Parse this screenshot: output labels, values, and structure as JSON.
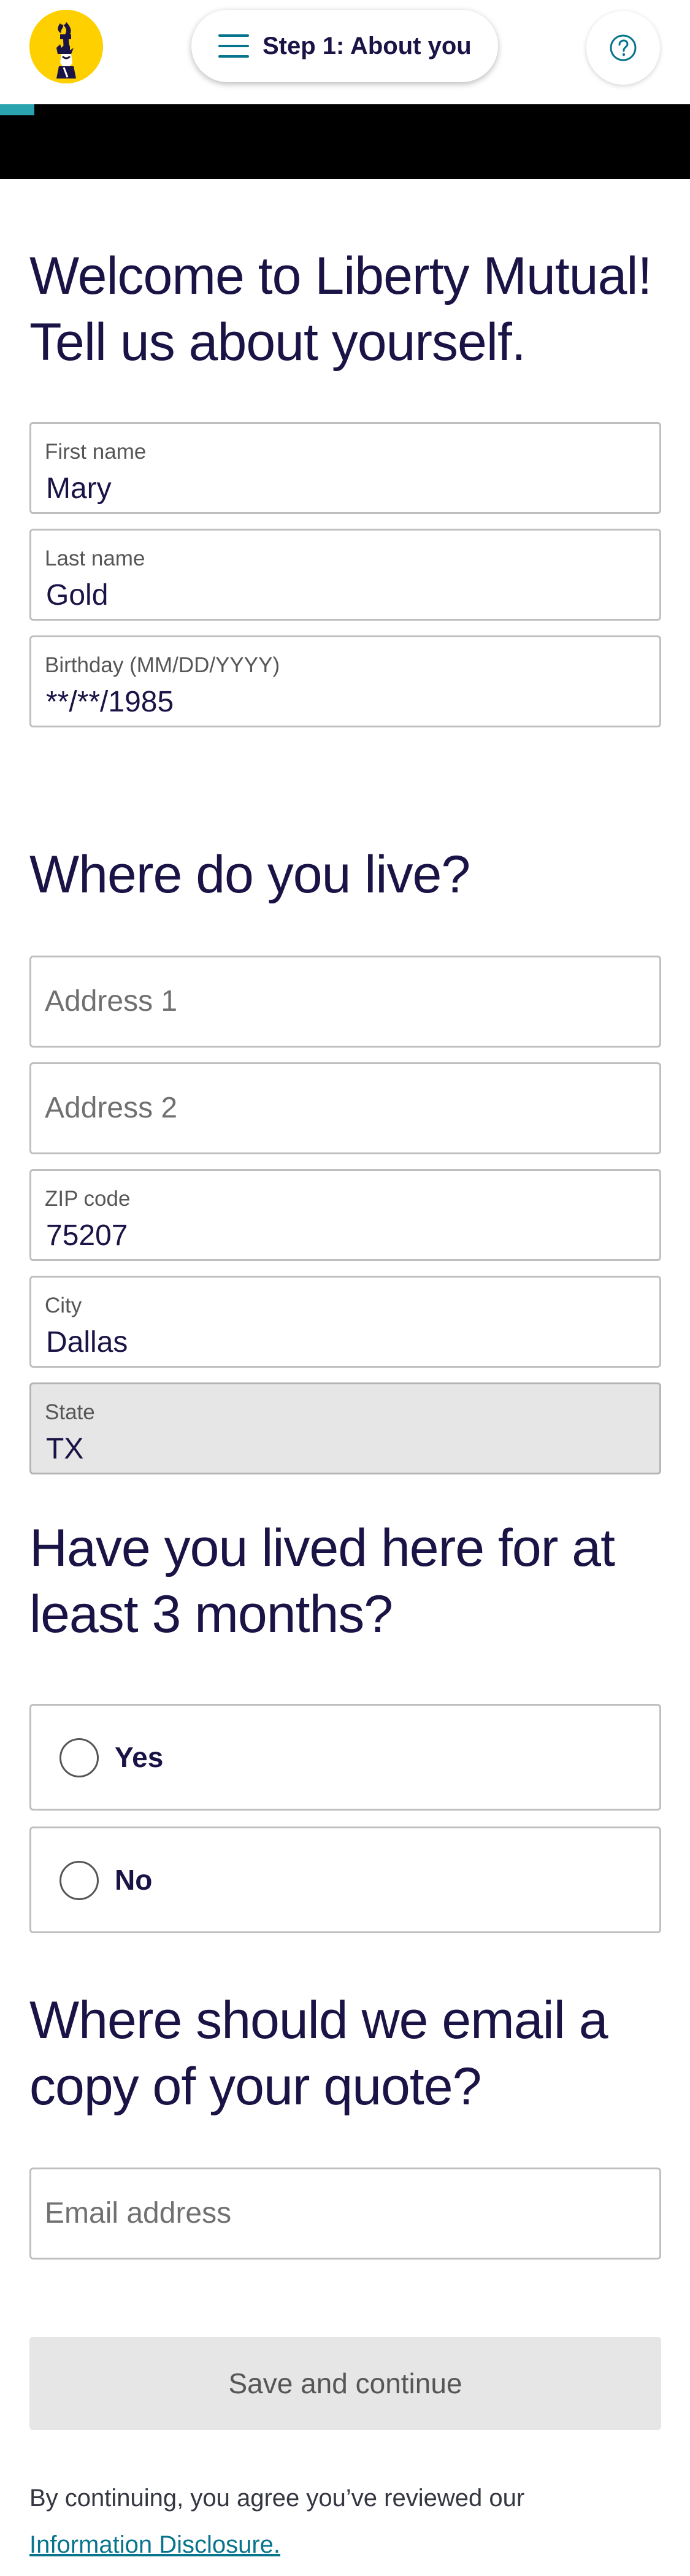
{
  "header": {
    "logo_name": "liberty-mutual-logo",
    "step_title": "Step 1: About you",
    "menu_icon": "hamburger-menu-icon",
    "help_icon": "question-circle-icon"
  },
  "progress": {
    "fraction": 0.05,
    "accent_color": "#28a3af"
  },
  "about": {
    "heading": "Welcome to Liberty Mutual! Tell us about yourself.",
    "first_name": {
      "label": "First name",
      "value": "Mary"
    },
    "last_name": {
      "label": "Last name",
      "value": "Gold"
    },
    "birthday": {
      "label": "Birthday (MM/DD/YYYY)",
      "value": "**/**/1985"
    }
  },
  "address": {
    "heading": "Where do you live?",
    "address1": {
      "placeholder": "Address 1"
    },
    "address2": {
      "placeholder": "Address 2"
    },
    "zip": {
      "label": "ZIP code",
      "value": "75207"
    },
    "city": {
      "label": "City",
      "value": "Dallas"
    },
    "state": {
      "label": "State",
      "value": "TX"
    }
  },
  "residency": {
    "heading": "Have you lived here for at least 3 months?",
    "options": [
      "Yes",
      "No"
    ]
  },
  "email": {
    "heading": "Where should we email a copy of your quote?",
    "placeholder": "Email address"
  },
  "actions": {
    "save_label": "Save and continue"
  },
  "disclaimer": {
    "text": "By continuing, you agree you’ve reviewed our",
    "link_text": "Information Disclosure."
  }
}
